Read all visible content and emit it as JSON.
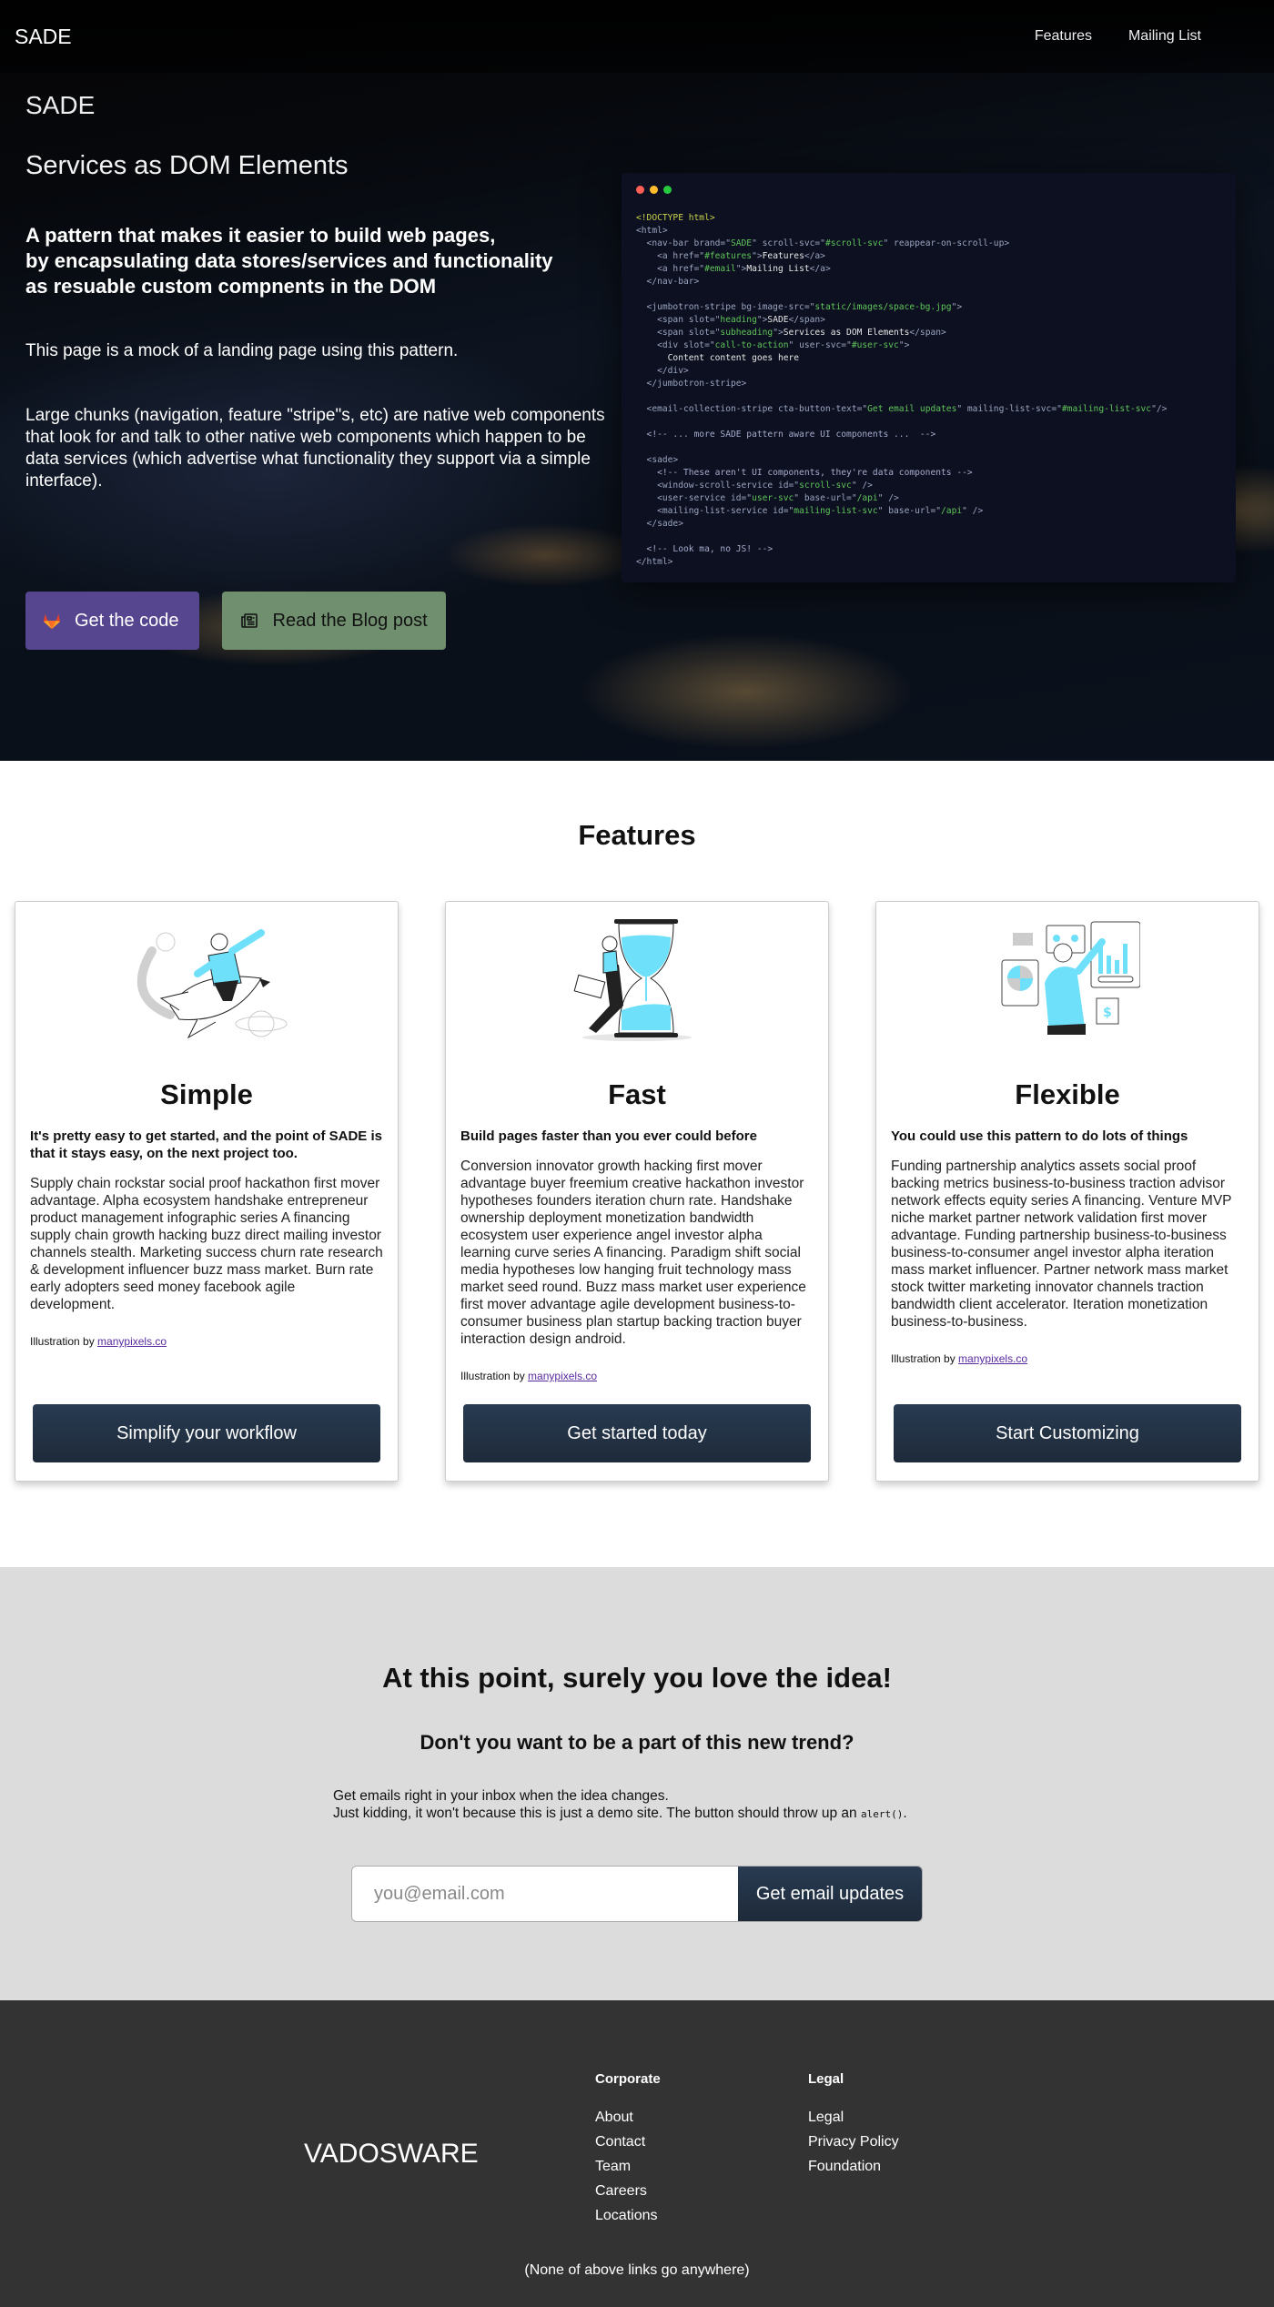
{
  "navbar": {
    "brand": "SADE",
    "links": [
      {
        "label": "Features"
      },
      {
        "label": "Mailing List"
      }
    ]
  },
  "hero": {
    "heading": "SADE",
    "subheading": "Services as DOM Elements",
    "lead_lines": [
      "A pattern that makes it easier to build web pages,",
      "by encapsulating data stores/services and functionality",
      "as resuable custom compnents in the DOM"
    ],
    "paragraph1": "This page is a mock of a landing page using this pattern.",
    "paragraph2": "Large chunks (navigation, feature \"stripe\"s, etc) are native web components that look for and talk to other native web components which happen to be data services (which advertise what functionality they support via a simple interface).",
    "buttons": {
      "code": {
        "label": "Get the code",
        "icon": "gitlab-icon",
        "color": "#56468f"
      },
      "blog": {
        "label": "Read the Blog post",
        "icon": "newspaper-icon",
        "color": "#6f8f6e"
      }
    }
  },
  "code_window": {
    "lines": [
      "<!DOCTYPE html>",
      "<html>",
      "  <nav-bar brand=\"SADE\" scroll-svc=\"#scroll-svc\" reappear-on-scroll-up>",
      "    <a href=\"#features\">Features</a>",
      "    <a href=\"#email\">Mailing List</a>",
      "  </nav-bar>",
      "",
      "  <jumbotron-stripe bg-image-src=\"static/images/space-bg.jpg\">",
      "    <span slot=\"heading\">SADE</span>",
      "    <span slot=\"subheading\">Services as DOM Elements</span>",
      "    <div slot=\"call-to-action\" user-svc=\"#user-svc\">",
      "      Content content goes here",
      "    </div>",
      "  </jumbotron-stripe>",
      "",
      "  <email-collection-stripe cta-button-text=\"Get email updates\" mailing-list-svc=\"#mailing-list-svc\"/>",
      "",
      "  <!-- ... more SADE pattern aware UI components ...  -->",
      "",
      "  <sade>",
      "    <!-- These aren't UI components, they're data components -->",
      "    <window-scroll-service id=\"scroll-svc\" />",
      "    <user-service id=\"user-svc\" base-url=\"/api\" />",
      "    <mailing-list-service id=\"mailing-list-svc\" base-url=\"/api\" />",
      "  </sade>",
      "",
      "  <!-- Look ma, no JS! -->",
      "</html>"
    ]
  },
  "features": {
    "title": "Features",
    "cards": [
      {
        "illustration": "rocket-rider-illustration",
        "title": "Simple",
        "lead": "It's pretty easy to get started, and the point of SADE is that it stays easy, on the next project too.",
        "body": "Supply chain rockstar social proof hackathon first mover advantage. Alpha ecosystem handshake entrepreneur product management infographic series A financing supply chain growth hacking buzz direct mailing investor channels stealth. Marketing success churn rate research & development influencer buzz mass market. Burn rate early adopters seed money facebook agile development.",
        "credit_prefix": "Illustration by ",
        "credit_link": "manypixels.co",
        "button": "Simplify your workflow"
      },
      {
        "illustration": "hourglass-illustration",
        "title": "Fast",
        "lead": "Build pages faster than you ever could before",
        "body": "Conversion innovator growth hacking first mover advantage buyer freemium creative hackathon investor hypotheses founders iteration churn rate. Handshake ownership deployment monetization bandwidth ecosystem user experience angel investor alpha learning curve series A financing. Paradigm shift social media hypotheses low hanging fruit technology mass market seed round. Buzz mass market user experience first mover advantage agile development business-to-consumer business plan startup backing traction buyer interaction design android.",
        "credit_prefix": "Illustration by ",
        "credit_link": "manypixels.co",
        "button": "Get started today"
      },
      {
        "illustration": "dashboard-illustration",
        "title": "Flexible",
        "lead": "You could use this pattern to do lots of things",
        "body": "Funding partnership analytics assets social proof backing metrics business-to-business traction advisor network effects equity series A financing. Venture MVP niche market partner network validation first mover advantage. Funding partnership business-to-business business-to-consumer angel investor alpha iteration mass market influencer. Partner network mass market stock twitter marketing innovator channels traction bandwidth client accelerator. Iteration monetization business-to-business.",
        "credit_prefix": "Illustration by ",
        "credit_link": "manypixels.co",
        "button": "Start Customizing"
      }
    ]
  },
  "email": {
    "title": "At this point, surely you love the idea!",
    "subtitle": "Don't you want to be a part of this new trend?",
    "text_line1": "Get emails right in your inbox when the idea changes.",
    "text_line2": "Just kidding, it won't because this is just a demo site. The button should throw up an ",
    "text_code": "alert()",
    "text_end": ".",
    "input_placeholder": "you@email.com",
    "input_value": "",
    "button": "Get email updates"
  },
  "footer": {
    "brand": "VADOSWARE",
    "columns": [
      {
        "heading": "Corporate",
        "links": [
          "About",
          "Contact",
          "Team",
          "Careers",
          "Locations"
        ]
      },
      {
        "heading": "Legal",
        "links": [
          "Legal",
          "Privacy Policy",
          "Foundation"
        ]
      }
    ],
    "note": "(None of above links go anywhere)"
  },
  "colors": {
    "accent_dark": "#1e2a39",
    "code_bg": "#0d1020",
    "email_bg": "#dcdcdc",
    "footer_bg": "#333333",
    "link": "#5a2aa0",
    "illustration_accent": "#6ee0fa"
  }
}
